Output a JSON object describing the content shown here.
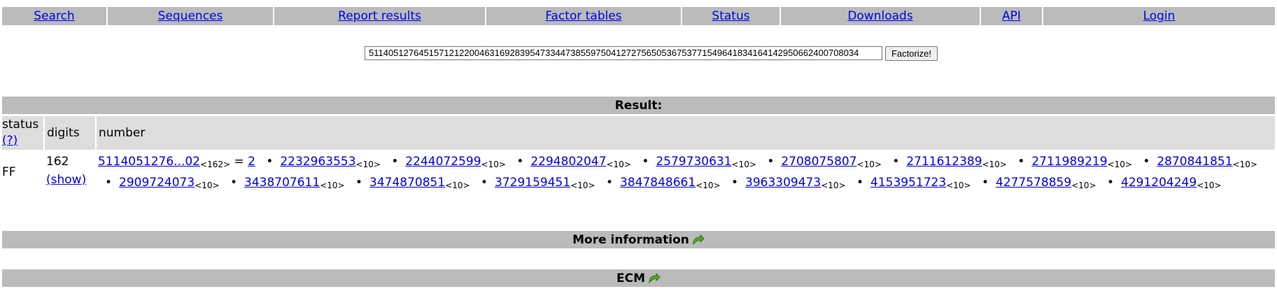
{
  "nav": [
    {
      "label": "Search"
    },
    {
      "label": "Sequences"
    },
    {
      "label": "Report results"
    },
    {
      "label": "Factor tables"
    },
    {
      "label": "Status"
    },
    {
      "label": "Downloads"
    },
    {
      "label": "API"
    },
    {
      "label": "Login"
    }
  ],
  "form": {
    "input_value": "5114051276451571212200463169283954733447385597504127275650536753771549641834164142950662400708034",
    "button_label": "Factorize!"
  },
  "result": {
    "header": "Result:",
    "columns": {
      "status": "status",
      "status_help": "(?)",
      "digits": "digits",
      "number": "number"
    },
    "row": {
      "status": "FF",
      "digits": "162",
      "show_link": "(show)",
      "number_link": "5114051276...02",
      "number_digits": "<162>",
      "equals": "=",
      "factors": [
        {
          "value": "2",
          "digits": ""
        },
        {
          "value": "2232963553",
          "digits": "<10>"
        },
        {
          "value": "2244072599",
          "digits": "<10>"
        },
        {
          "value": "2294802047",
          "digits": "<10>"
        },
        {
          "value": "2579730631",
          "digits": "<10>"
        },
        {
          "value": "2708075807",
          "digits": "<10>"
        },
        {
          "value": "2711612389",
          "digits": "<10>"
        },
        {
          "value": "2711989219",
          "digits": "<10>"
        },
        {
          "value": "2870841851",
          "digits": "<10>"
        },
        {
          "value": "2909724073",
          "digits": "<10>"
        },
        {
          "value": "3438707611",
          "digits": "<10>"
        },
        {
          "value": "3474870851",
          "digits": "<10>"
        },
        {
          "value": "3729159451",
          "digits": "<10>"
        },
        {
          "value": "3847848661",
          "digits": "<10>"
        },
        {
          "value": "3963309473",
          "digits": "<10>"
        },
        {
          "value": "4153951723",
          "digits": "<10>"
        },
        {
          "value": "4277578859",
          "digits": "<10>"
        },
        {
          "value": "4291204249",
          "digits": "<10>"
        }
      ],
      "separator": "•"
    }
  },
  "sections": {
    "more_info": "More information",
    "ecm": "ECM"
  },
  "icons": {
    "expand_arrow": "green-curved-arrow-icon"
  },
  "colors": {
    "bar": "#bbbbbb",
    "header_row": "#dddddd",
    "link": "#0000ee",
    "arrow": "#55aa22"
  }
}
